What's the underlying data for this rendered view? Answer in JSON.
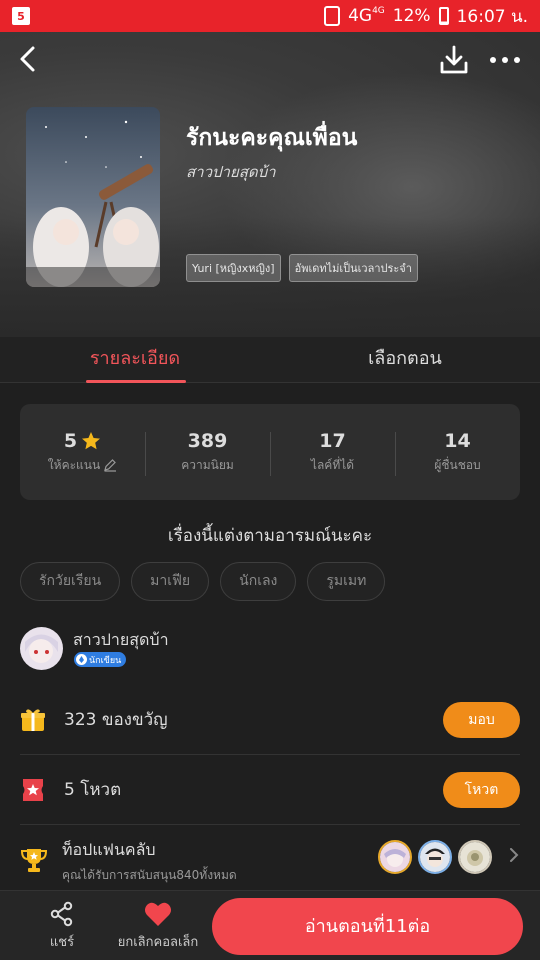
{
  "status_bar": {
    "network": "4G",
    "network_sup": "4G",
    "battery": "12%",
    "time": "16:07 น."
  },
  "book": {
    "title": "รักนะคะคุณเพื่อน",
    "author": "สาวปายสุดบ้า",
    "tags": [
      "Yuri [หญิงxหญิง]",
      "อัพเดทไม่เป็นเวลาประจำ"
    ]
  },
  "tabs": [
    {
      "label": "รายละเอียด",
      "active": true
    },
    {
      "label": "เลือกตอน",
      "active": false
    }
  ],
  "stats": [
    {
      "value": "5",
      "label": "ให้คะแนน"
    },
    {
      "value": "389",
      "label": "ความนิยม"
    },
    {
      "value": "17",
      "label": "ไลค์ที่ได้"
    },
    {
      "value": "14",
      "label": "ผู้ชื่นชอบ"
    }
  ],
  "synopsis": "เรื่องนี้แต่งตามอารมณ์นะคะ",
  "genre_chips": [
    "รักวัยเรียน",
    "มาเฟีย",
    "นักเลง",
    "รูมเมท"
  ],
  "writer": {
    "name": "สาวปายสุดบ้า",
    "badge": "นักเขียน"
  },
  "gifts": {
    "text": "323 ของขวัญ",
    "button": "มอบ"
  },
  "votes": {
    "text": "5 โหวต",
    "button": "โหวต"
  },
  "fanclub": {
    "title": "ท็อปแฟนคลับ",
    "subtitle": "คุณได้รับการสนับสนุน840ทั้งหมด"
  },
  "bottom_bar": {
    "share": "แชร์",
    "unfavorite": "ยกเลิกคอลเล็ก",
    "read": "อ่านตอนที่11ต่อ"
  },
  "colors": {
    "status_bar": "#e8232a",
    "accent": "#f2555a",
    "orange": "#f08c19",
    "read_button": "#f1464d"
  }
}
